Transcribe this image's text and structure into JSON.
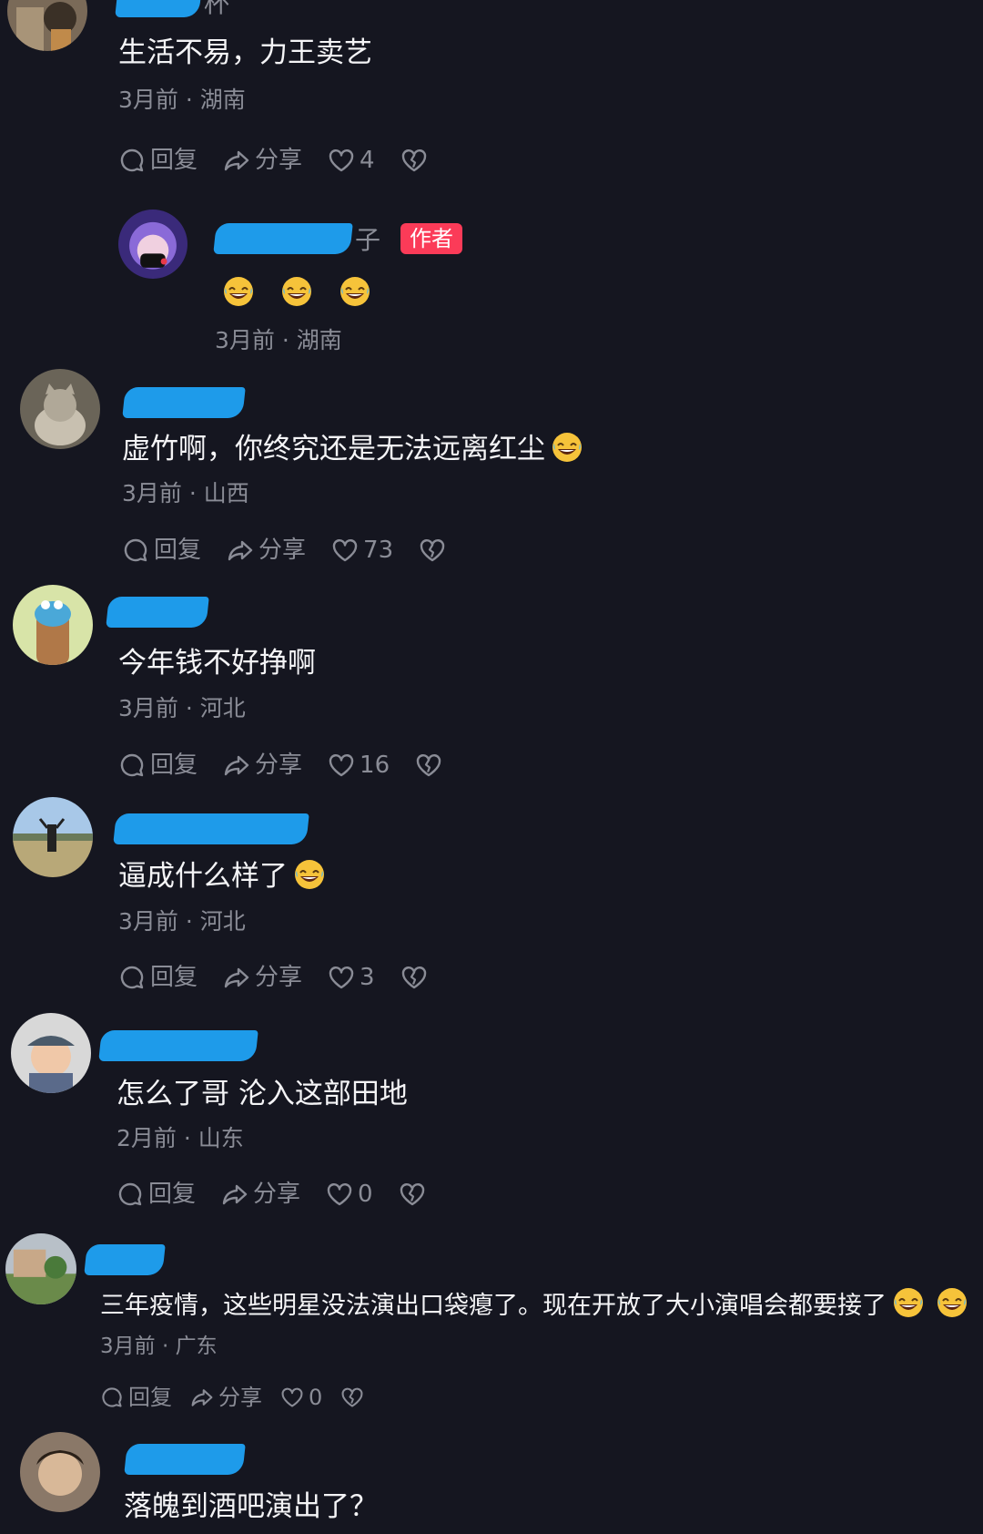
{
  "labels": {
    "reply": "回复",
    "share": "分享",
    "author": "作者"
  },
  "comments": [
    {
      "name_tail": "杯",
      "text": "生活不易，力王卖艺",
      "meta": "3月前 · 湖南",
      "likes": "4"
    },
    {
      "name_tail": "子",
      "emoji": "🤣🤣🤣",
      "meta": "3月前 · 湖南"
    },
    {
      "text": "虚竹啊，你终究还是无法远离红尘",
      "meta": "3月前 · 山西",
      "likes": "73"
    },
    {
      "text": "今年钱不好挣啊",
      "meta": "3月前 · 河北",
      "likes": "16"
    },
    {
      "text": "逼成什么样了",
      "meta": "3月前 · 河北",
      "likes": "3"
    },
    {
      "text": "怎么了哥 沦入这部田地",
      "meta": "2月前 · 山东",
      "likes": "0"
    },
    {
      "text": "三年疫情，这些明星没法演出口袋瘪了。现在开放了大小演唱会都要接了",
      "meta": "3月前 · 广东",
      "likes": "0"
    },
    {
      "text": "落魄到酒吧演出了？"
    }
  ],
  "colors": {
    "background": "#151620",
    "author_badge": "#fb3b58",
    "secondary_text": "#8a8c96"
  },
  "icons": [
    "comment-bubble-icon",
    "share-arrow-icon",
    "heart-icon",
    "broken-heart-icon",
    "laughing-emoji-icon"
  ]
}
